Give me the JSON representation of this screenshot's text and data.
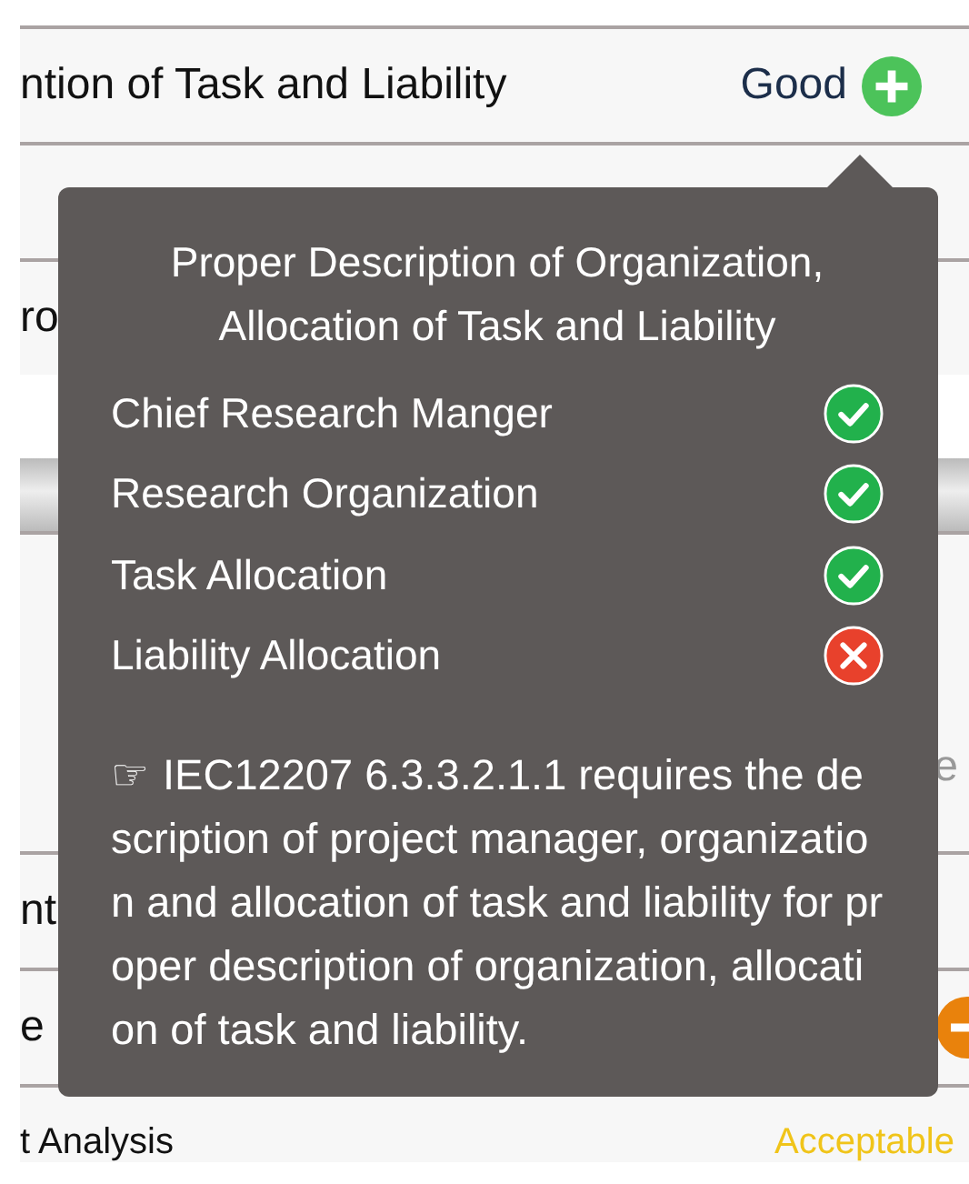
{
  "rows": [
    {
      "label": "ntion of Task and Liability",
      "value": "Good",
      "color": "#1c2e4a",
      "kind": "positive"
    },
    {
      "kind": "plain",
      "label": ""
    },
    {
      "kind": "plain",
      "label": "ro"
    },
    {
      "kind": "band"
    },
    {
      "kind": "plain",
      "label": "",
      "value": "e",
      "color": "#999999"
    },
    {
      "kind": "plain",
      "label": "nt"
    },
    {
      "kind": "negative",
      "label": "e"
    },
    {
      "kind": "plain",
      "label": "t Analysis",
      "value": "Acceptable",
      "color": "#f0c419"
    }
  ],
  "tooltip": {
    "title": "Proper Description of Organization, Allocation of Task and Liability",
    "checks": [
      {
        "label": "Chief Research Manger",
        "passed": true
      },
      {
        "label": "Research Organization",
        "passed": true
      },
      {
        "label": "Task Allocation",
        "passed": true
      },
      {
        "label": "Liability Allocation",
        "passed": false
      }
    ],
    "pointer": "☞",
    "message": "IEC12207 6.3.3.2.1.1 requires the description of project manager, organization and allocation of task and liability for proper description of organization, allocation of task and liability."
  }
}
